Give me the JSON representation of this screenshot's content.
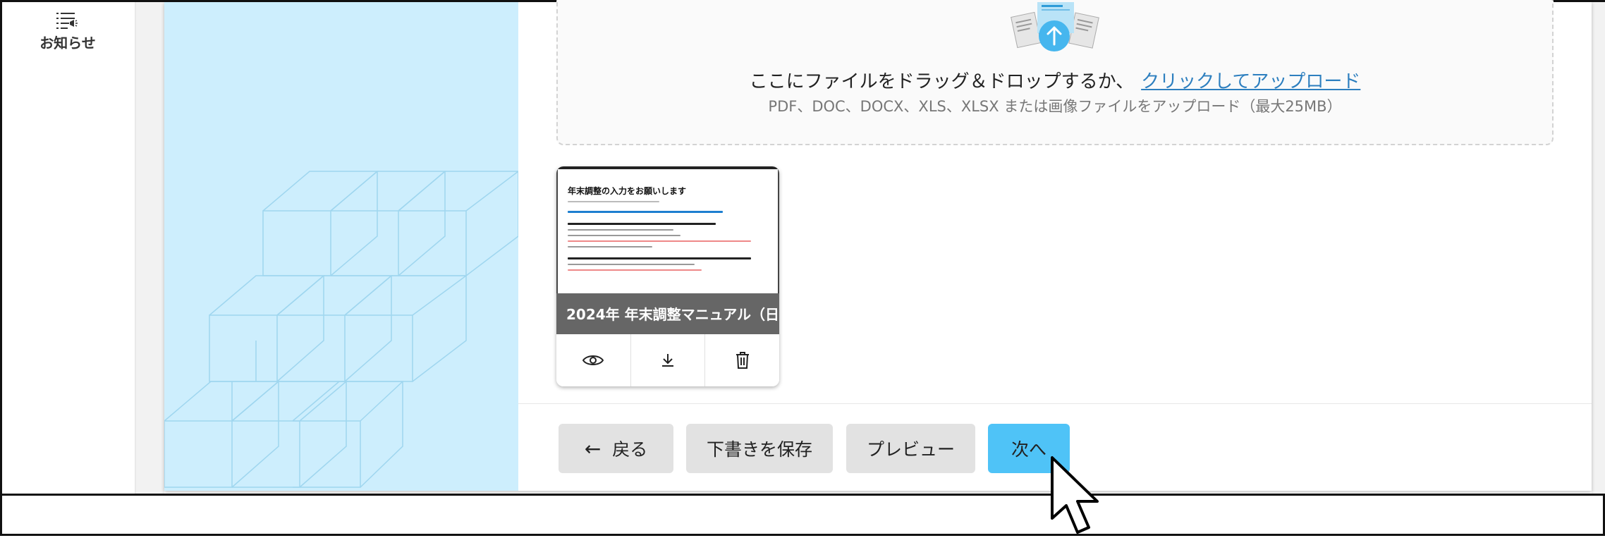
{
  "sidebar": {
    "items": [
      {
        "label": "お知らせ",
        "icon": "notification-list-icon"
      }
    ]
  },
  "upload": {
    "main_text": "ここにファイルをドラッグ＆ドロップするか、",
    "link_text": "クリックしてアップロード",
    "sub_text": "PDF、DOC、DOCX、XLS、XLSX または画像ファイルをアップロード（最大25MB）",
    "icon": "upload-arrow-icon"
  },
  "file": {
    "name": "2024年 年末調整マニュアル（日...",
    "thumbnail_title": "年末調整の入力をお願いします",
    "actions": [
      {
        "icon": "eye-icon"
      },
      {
        "icon": "download-icon"
      },
      {
        "icon": "trash-icon"
      }
    ]
  },
  "footer": {
    "back_label": "戻る",
    "draft_label": "下書きを保存",
    "preview_label": "プレビュー",
    "next_label": "次へ"
  },
  "colors": {
    "accent": "#4fc3f7",
    "art_background": "#cdeefd",
    "link": "#2d7fbf",
    "button_gray": "#e2e2e2",
    "caption_bg": "#666666"
  }
}
